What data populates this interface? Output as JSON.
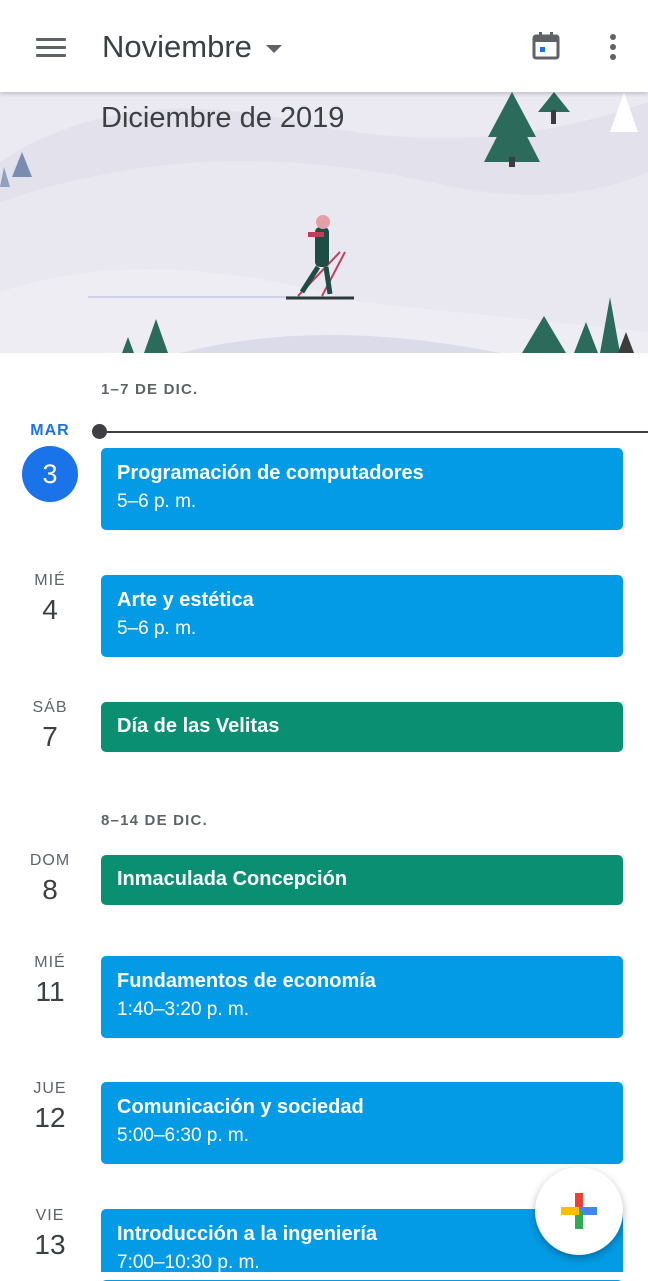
{
  "appbar": {
    "month": "Noviembre",
    "icons": {
      "menu": "menu-icon",
      "dropdown": "dropdown-icon",
      "today": "calendar-today-icon",
      "more": "more-vert-icon"
    }
  },
  "banner": {
    "title": "Diciembre de 2019"
  },
  "weeks": [
    {
      "label": "1–7 DE DIC."
    },
    {
      "label": "8–14 DE DIC."
    }
  ],
  "days": [
    {
      "dow": "MAR",
      "num": "3",
      "today": true
    },
    {
      "dow": "MIÉ",
      "num": "4"
    },
    {
      "dow": "SÁB",
      "num": "7"
    },
    {
      "dow": "DOM",
      "num": "8"
    },
    {
      "dow": "MIÉ",
      "num": "11"
    },
    {
      "dow": "JUE",
      "num": "12"
    },
    {
      "dow": "VIE",
      "num": "13"
    }
  ],
  "events": [
    {
      "title": "Programación de computadores",
      "time": "5–6 p. m.",
      "color": "#039be5"
    },
    {
      "title": "Arte y estética",
      "time": "5–6 p. m.",
      "color": "#039be5"
    },
    {
      "title": "Día de las Velitas",
      "color": "#0b8f74"
    },
    {
      "title": "Inmaculada Concepción",
      "color": "#0b8f74"
    },
    {
      "title": "Fundamentos de economía",
      "time": "1:40–3:20 p. m.",
      "color": "#039be5"
    },
    {
      "title": "Comunicación y sociedad",
      "time": "5:00–6:30 p. m.",
      "color": "#039be5"
    },
    {
      "title": "Introducción a la ingeniería",
      "time": "7:00–10:30 p. m.",
      "color": "#039be5"
    }
  ],
  "fab": {
    "icon": "add-icon",
    "colors": [
      "#ea4335",
      "#4285f4",
      "#34a853",
      "#fbbc04"
    ]
  },
  "colors": {
    "accent": "#1a73e8"
  }
}
